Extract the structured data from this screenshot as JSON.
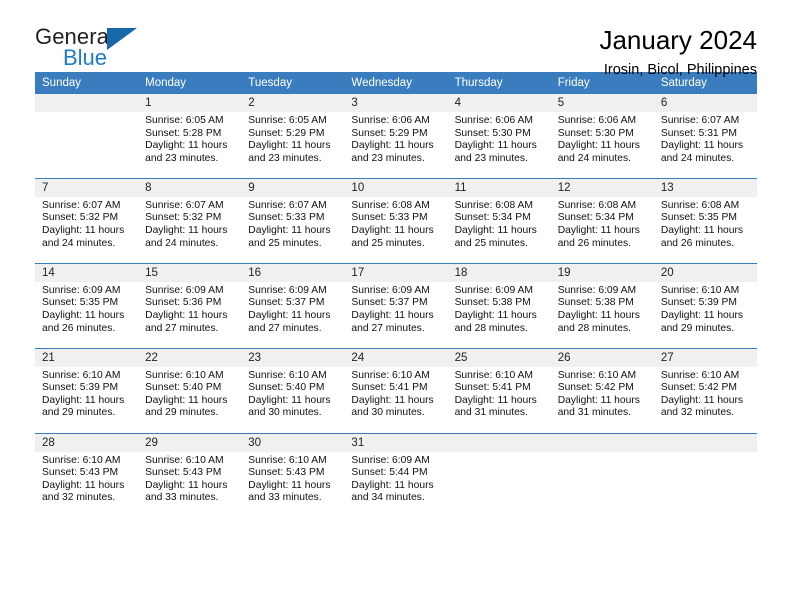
{
  "brand": {
    "name_part1": "General",
    "name_part2": "Blue",
    "flag_icon": "triangle-flag-icon",
    "color_primary": "#1868ab",
    "color_text": "#231f20"
  },
  "header": {
    "title": "January 2024",
    "subtitle": "Irosin, Bicol, Philippines"
  },
  "calendar": {
    "header_bg": "#3a7dbf",
    "daynum_bg": "#f0f0f0",
    "weekdays": [
      "Sunday",
      "Monday",
      "Tuesday",
      "Wednesday",
      "Thursday",
      "Friday",
      "Saturday"
    ],
    "weeks": [
      {
        "days": [
          {
            "num": "",
            "sunrise": "",
            "sunset": "",
            "daylight_l1": "",
            "daylight_l2": ""
          },
          {
            "num": "1",
            "sunrise": "Sunrise: 6:05 AM",
            "sunset": "Sunset: 5:28 PM",
            "daylight_l1": "Daylight: 11 hours",
            "daylight_l2": "and 23 minutes."
          },
          {
            "num": "2",
            "sunrise": "Sunrise: 6:05 AM",
            "sunset": "Sunset: 5:29 PM",
            "daylight_l1": "Daylight: 11 hours",
            "daylight_l2": "and 23 minutes."
          },
          {
            "num": "3",
            "sunrise": "Sunrise: 6:06 AM",
            "sunset": "Sunset: 5:29 PM",
            "daylight_l1": "Daylight: 11 hours",
            "daylight_l2": "and 23 minutes."
          },
          {
            "num": "4",
            "sunrise": "Sunrise: 6:06 AM",
            "sunset": "Sunset: 5:30 PM",
            "daylight_l1": "Daylight: 11 hours",
            "daylight_l2": "and 23 minutes."
          },
          {
            "num": "5",
            "sunrise": "Sunrise: 6:06 AM",
            "sunset": "Sunset: 5:30 PM",
            "daylight_l1": "Daylight: 11 hours",
            "daylight_l2": "and 24 minutes."
          },
          {
            "num": "6",
            "sunrise": "Sunrise: 6:07 AM",
            "sunset": "Sunset: 5:31 PM",
            "daylight_l1": "Daylight: 11 hours",
            "daylight_l2": "and 24 minutes."
          }
        ]
      },
      {
        "days": [
          {
            "num": "7",
            "sunrise": "Sunrise: 6:07 AM",
            "sunset": "Sunset: 5:32 PM",
            "daylight_l1": "Daylight: 11 hours",
            "daylight_l2": "and 24 minutes."
          },
          {
            "num": "8",
            "sunrise": "Sunrise: 6:07 AM",
            "sunset": "Sunset: 5:32 PM",
            "daylight_l1": "Daylight: 11 hours",
            "daylight_l2": "and 24 minutes."
          },
          {
            "num": "9",
            "sunrise": "Sunrise: 6:07 AM",
            "sunset": "Sunset: 5:33 PM",
            "daylight_l1": "Daylight: 11 hours",
            "daylight_l2": "and 25 minutes."
          },
          {
            "num": "10",
            "sunrise": "Sunrise: 6:08 AM",
            "sunset": "Sunset: 5:33 PM",
            "daylight_l1": "Daylight: 11 hours",
            "daylight_l2": "and 25 minutes."
          },
          {
            "num": "11",
            "sunrise": "Sunrise: 6:08 AM",
            "sunset": "Sunset: 5:34 PM",
            "daylight_l1": "Daylight: 11 hours",
            "daylight_l2": "and 25 minutes."
          },
          {
            "num": "12",
            "sunrise": "Sunrise: 6:08 AM",
            "sunset": "Sunset: 5:34 PM",
            "daylight_l1": "Daylight: 11 hours",
            "daylight_l2": "and 26 minutes."
          },
          {
            "num": "13",
            "sunrise": "Sunrise: 6:08 AM",
            "sunset": "Sunset: 5:35 PM",
            "daylight_l1": "Daylight: 11 hours",
            "daylight_l2": "and 26 minutes."
          }
        ]
      },
      {
        "days": [
          {
            "num": "14",
            "sunrise": "Sunrise: 6:09 AM",
            "sunset": "Sunset: 5:35 PM",
            "daylight_l1": "Daylight: 11 hours",
            "daylight_l2": "and 26 minutes."
          },
          {
            "num": "15",
            "sunrise": "Sunrise: 6:09 AM",
            "sunset": "Sunset: 5:36 PM",
            "daylight_l1": "Daylight: 11 hours",
            "daylight_l2": "and 27 minutes."
          },
          {
            "num": "16",
            "sunrise": "Sunrise: 6:09 AM",
            "sunset": "Sunset: 5:37 PM",
            "daylight_l1": "Daylight: 11 hours",
            "daylight_l2": "and 27 minutes."
          },
          {
            "num": "17",
            "sunrise": "Sunrise: 6:09 AM",
            "sunset": "Sunset: 5:37 PM",
            "daylight_l1": "Daylight: 11 hours",
            "daylight_l2": "and 27 minutes."
          },
          {
            "num": "18",
            "sunrise": "Sunrise: 6:09 AM",
            "sunset": "Sunset: 5:38 PM",
            "daylight_l1": "Daylight: 11 hours",
            "daylight_l2": "and 28 minutes."
          },
          {
            "num": "19",
            "sunrise": "Sunrise: 6:09 AM",
            "sunset": "Sunset: 5:38 PM",
            "daylight_l1": "Daylight: 11 hours",
            "daylight_l2": "and 28 minutes."
          },
          {
            "num": "20",
            "sunrise": "Sunrise: 6:10 AM",
            "sunset": "Sunset: 5:39 PM",
            "daylight_l1": "Daylight: 11 hours",
            "daylight_l2": "and 29 minutes."
          }
        ]
      },
      {
        "days": [
          {
            "num": "21",
            "sunrise": "Sunrise: 6:10 AM",
            "sunset": "Sunset: 5:39 PM",
            "daylight_l1": "Daylight: 11 hours",
            "daylight_l2": "and 29 minutes."
          },
          {
            "num": "22",
            "sunrise": "Sunrise: 6:10 AM",
            "sunset": "Sunset: 5:40 PM",
            "daylight_l1": "Daylight: 11 hours",
            "daylight_l2": "and 29 minutes."
          },
          {
            "num": "23",
            "sunrise": "Sunrise: 6:10 AM",
            "sunset": "Sunset: 5:40 PM",
            "daylight_l1": "Daylight: 11 hours",
            "daylight_l2": "and 30 minutes."
          },
          {
            "num": "24",
            "sunrise": "Sunrise: 6:10 AM",
            "sunset": "Sunset: 5:41 PM",
            "daylight_l1": "Daylight: 11 hours",
            "daylight_l2": "and 30 minutes."
          },
          {
            "num": "25",
            "sunrise": "Sunrise: 6:10 AM",
            "sunset": "Sunset: 5:41 PM",
            "daylight_l1": "Daylight: 11 hours",
            "daylight_l2": "and 31 minutes."
          },
          {
            "num": "26",
            "sunrise": "Sunrise: 6:10 AM",
            "sunset": "Sunset: 5:42 PM",
            "daylight_l1": "Daylight: 11 hours",
            "daylight_l2": "and 31 minutes."
          },
          {
            "num": "27",
            "sunrise": "Sunrise: 6:10 AM",
            "sunset": "Sunset: 5:42 PM",
            "daylight_l1": "Daylight: 11 hours",
            "daylight_l2": "and 32 minutes."
          }
        ]
      },
      {
        "days": [
          {
            "num": "28",
            "sunrise": "Sunrise: 6:10 AM",
            "sunset": "Sunset: 5:43 PM",
            "daylight_l1": "Daylight: 11 hours",
            "daylight_l2": "and 32 minutes."
          },
          {
            "num": "29",
            "sunrise": "Sunrise: 6:10 AM",
            "sunset": "Sunset: 5:43 PM",
            "daylight_l1": "Daylight: 11 hours",
            "daylight_l2": "and 33 minutes."
          },
          {
            "num": "30",
            "sunrise": "Sunrise: 6:10 AM",
            "sunset": "Sunset: 5:43 PM",
            "daylight_l1": "Daylight: 11 hours",
            "daylight_l2": "and 33 minutes."
          },
          {
            "num": "31",
            "sunrise": "Sunrise: 6:09 AM",
            "sunset": "Sunset: 5:44 PM",
            "daylight_l1": "Daylight: 11 hours",
            "daylight_l2": "and 34 minutes."
          },
          {
            "num": "",
            "sunrise": "",
            "sunset": "",
            "daylight_l1": "",
            "daylight_l2": ""
          },
          {
            "num": "",
            "sunrise": "",
            "sunset": "",
            "daylight_l1": "",
            "daylight_l2": ""
          },
          {
            "num": "",
            "sunrise": "",
            "sunset": "",
            "daylight_l1": "",
            "daylight_l2": ""
          }
        ]
      }
    ]
  }
}
